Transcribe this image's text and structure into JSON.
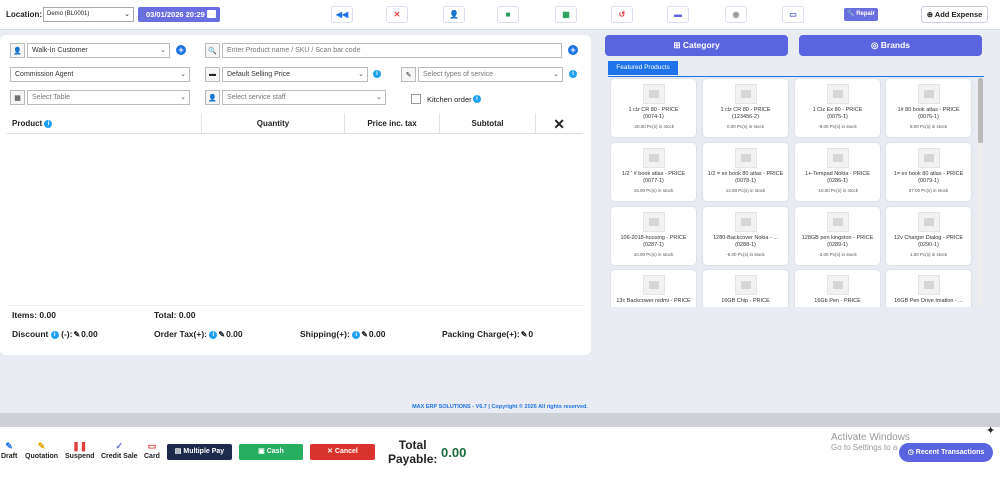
{
  "topbar": {
    "location_label": "Location:",
    "location_value": "Demo (BL0001)",
    "datetime": "03/01/2026 20:29",
    "repair_label": "Repair",
    "add_expense_label": "Add Expense",
    "icons": [
      {
        "name": "rewind-icon",
        "glyph": "◀◀",
        "color": "#1e73e8"
      },
      {
        "name": "close-register-icon",
        "glyph": "✕",
        "color": "#e23b3b"
      },
      {
        "name": "add-user-icon",
        "glyph": "👤",
        "color": "#6a6fe0"
      },
      {
        "name": "briefcase-icon",
        "glyph": "■",
        "color": "#1f9d55"
      },
      {
        "name": "calculator-icon",
        "glyph": "▦",
        "color": "#1f9d55"
      },
      {
        "name": "undo-icon",
        "glyph": "↺",
        "color": "#e23b3b"
      },
      {
        "name": "wallet-icon",
        "glyph": "▬",
        "color": "#5a63e0"
      },
      {
        "name": "settings-icon",
        "glyph": "◉",
        "color": "#999"
      },
      {
        "name": "monitor-icon",
        "glyph": "▭",
        "color": "#5a63e0"
      }
    ]
  },
  "form": {
    "customer": "Walk-In Customer",
    "product_search_placeholder": "Enter Product name / SKU / Scan bar code",
    "commission_agent": "Commission Agent",
    "selling_price": "Default Selling Price",
    "service_types_placeholder": "Select types of service",
    "table_placeholder": "Select Table",
    "service_staff_placeholder": "Select service staff",
    "kitchen_order": "Kitchen order"
  },
  "table": {
    "headers": [
      "Product",
      "Quantity",
      "Price inc. tax",
      "Subtotal"
    ]
  },
  "summary": {
    "items_label": "Items:",
    "items_value": "0.00",
    "total_label": "Total:",
    "total_value": "0.00",
    "discount_label": "Discount",
    "discount_sign": "(-):",
    "discount_value": "0.00",
    "order_tax_label": "Order Tax(+):",
    "order_tax_value": "0.00",
    "shipping_label": "Shipping(+):",
    "shipping_value": "0.00",
    "packing_label": "Packing Charge(+):",
    "packing_value": "0"
  },
  "right": {
    "category_label": "Category",
    "brands_label": "Brands",
    "featured_tab": "Featured Products",
    "products": [
      {
        "name": "1 clz CR 80 - PRICE",
        "sku": "(0074-1)",
        "stock": "-20.00 Pc(s) in stock"
      },
      {
        "name": "1 clz CR 80 - PRICE",
        "sku": "(123456-2)",
        "stock": "0.00 Pc(s) in stock"
      },
      {
        "name": "1 Clz Ex 80 - PRICE",
        "sku": "(0075-1)",
        "stock": "-9.00 Pc(s) in stock"
      },
      {
        "name": "1# 80 book atlas - PRICE",
        "sku": "(0076-1)",
        "stock": "8.00 Pc(s) in stock"
      },
      {
        "name": "1/2 ' # book atlas - PRICE",
        "sku": "(0077-1)",
        "stock": "15.00 Pc(s) in stock"
      },
      {
        "name": "1/2 = ex book 80 atlas - PRICE",
        "sku": "(0078-1)",
        "stock": "14.00 Pc(s) in stock"
      },
      {
        "name": "1+-Tempad Nokia - PRICE",
        "sku": "(0286-1)",
        "stock": "-10.00 Pc(s) in stock"
      },
      {
        "name": "1= ex book 80 atlas - PRICE",
        "sku": "(0079-1)",
        "stock": "27.00 Pc(s) in stock"
      },
      {
        "name": "106-2018-housing - PRICE",
        "sku": "(0287-1)",
        "stock": "10.00 Pc(s) in stock"
      },
      {
        "name": "1280-Backcover Nokia - ...",
        "sku": "(0288-1)",
        "stock": "-6.00 Pc(s) in stock"
      },
      {
        "name": "128GB pen kingston - PRICE",
        "sku": "(0289-1)",
        "stock": "-3.00 Pc(s) in stock"
      },
      {
        "name": "12v Charger Dialog - PRICE",
        "sku": "(0290-1)",
        "stock": "1.00 Pc(s) in stock"
      },
      {
        "name": "13c Backcower redmi - PRICE",
        "sku": "",
        "stock": ""
      },
      {
        "name": "16GB Chip - PRICE",
        "sku": "",
        "stock": ""
      },
      {
        "name": "16Gb Pen - PRICE",
        "sku": "",
        "stock": ""
      },
      {
        "name": "16GB Pen Drive Imation - ...",
        "sku": "",
        "stock": ""
      }
    ]
  },
  "footer": {
    "copyright": "MAX ERP SOLUTIONS - V6.7 | Copyright © 2026 All rights reserved.",
    "draft": "Draft",
    "quotation": "Quotation",
    "suspend": "Suspend",
    "credit_sale": "Credit Sale",
    "card": "Card",
    "multiple_pay": "Multiple Pay",
    "cash": "Cash",
    "cancel": "Cancel",
    "total_payable_line1": "Total",
    "total_payable_line2": "Payable:",
    "total_payable_value": "0.00",
    "activate_title": "Activate Windows",
    "activate_sub": "Go to Settings to a",
    "recent_transactions": "Recent Transactions"
  }
}
